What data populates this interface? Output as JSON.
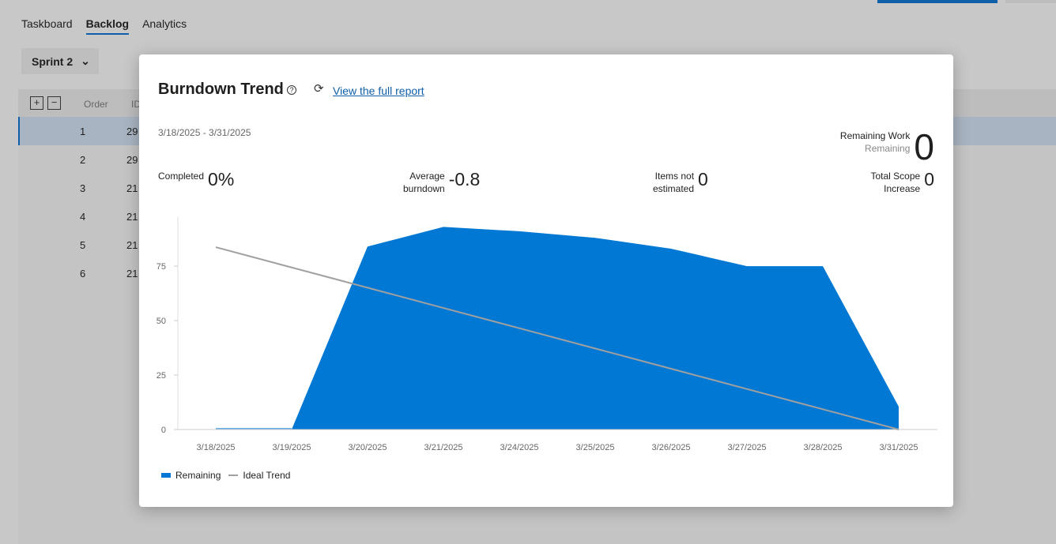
{
  "tabs": [
    "Taskboard",
    "Backlog",
    "Analytics"
  ],
  "sprint": "Sprint 2",
  "grid": {
    "headers": [
      "Order",
      "ID"
    ],
    "rows": [
      {
        "order": "1",
        "id": "29"
      },
      {
        "order": "2",
        "id": "29"
      },
      {
        "order": "3",
        "id": "21"
      },
      {
        "order": "4",
        "id": "21"
      },
      {
        "order": "5",
        "id": "21"
      },
      {
        "order": "6",
        "id": "21"
      }
    ]
  },
  "dialog": {
    "title": "Burndown Trend",
    "help": "?",
    "refresh": "⟳",
    "link": "View the full report",
    "range": "3/18/2025 - 3/31/2025",
    "remaining_label": "Remaining Work",
    "remaining_sub": "Remaining",
    "remaining_value": "0",
    "completed_label": "Completed",
    "completed_value": "0%",
    "avg_label1": "Average",
    "avg_label2": "burndown",
    "avg_value": "-0.8",
    "items_label1": "Items not",
    "items_label2": "estimated",
    "items_value": "0",
    "scope_label1": "Total Scope",
    "scope_label2": "Increase",
    "scope_value": "0"
  },
  "chart_data": {
    "type": "area",
    "x": [
      "3/18/2025",
      "3/19/2025",
      "3/20/2025",
      "3/21/2025",
      "3/24/2025",
      "3/25/2025",
      "3/26/2025",
      "3/27/2025",
      "3/28/2025",
      "3/31/2025"
    ],
    "series": [
      {
        "name": "Remaining",
        "type": "area",
        "color": "#0078d4",
        "values": [
          0,
          0,
          84,
          93,
          91,
          88,
          83,
          75,
          75,
          10.5
        ]
      },
      {
        "name": "Ideal Trend",
        "type": "line",
        "color": "#a0a0a0",
        "values": [
          83.7,
          74.4,
          65.1,
          55.8,
          46.5,
          37.2,
          27.9,
          18.6,
          9.3,
          0
        ]
      }
    ],
    "yticks": [
      0,
      25,
      50,
      75
    ],
    "ylim": [
      0,
      97.5
    ],
    "legend": "bottom-left"
  }
}
